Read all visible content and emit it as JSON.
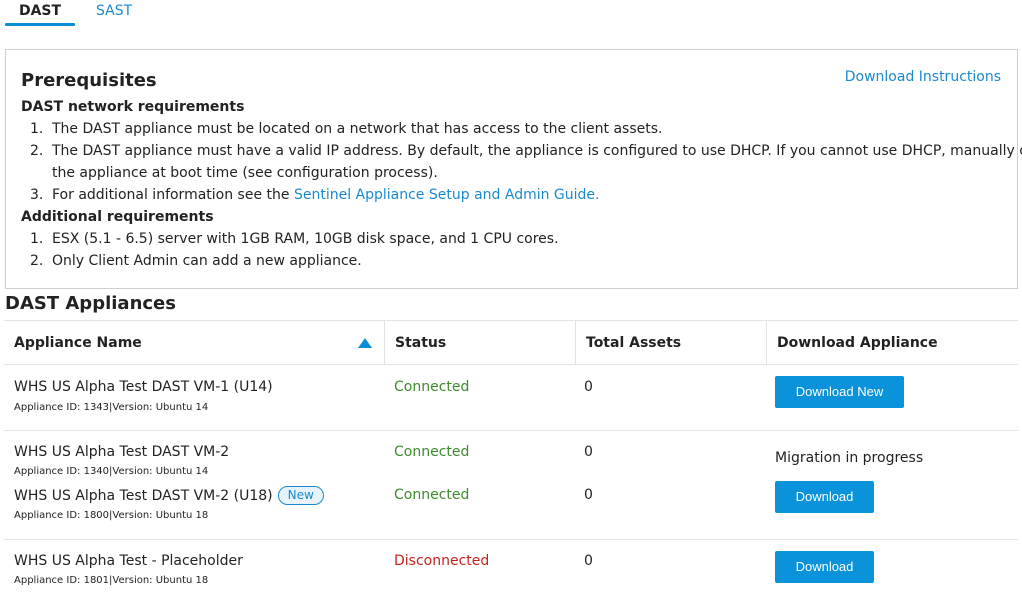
{
  "tabs": [
    {
      "label": "DAST",
      "active": true
    },
    {
      "label": "SAST",
      "active": false
    }
  ],
  "prerequisites": {
    "title": "Prerequisites",
    "download_instructions_label": "Download Instructions",
    "network_heading": "DAST network requirements",
    "network_items": [
      {
        "num": "1.",
        "text": "The DAST appliance must be located on a network that has access to the client assets."
      },
      {
        "num": "2.",
        "text": "The DAST appliance must have a valid IP address. By default, the appliance is configured to use DHCP. If you cannot use DHCP, manually configure",
        "continuation": "the appliance at boot time (see configuration process)."
      },
      {
        "num": "3.",
        "text": "For additional information see the ",
        "link": "Sentinel Appliance Setup and Admin Guide."
      }
    ],
    "additional_heading": "Additional requirements",
    "additional_items": [
      {
        "num": "1.",
        "text": "ESX (5.1 - 6.5) server with 1GB RAM, 10GB disk space, and 1 CPU cores."
      },
      {
        "num": "2.",
        "text": "Only Client Admin can add a new appliance."
      }
    ]
  },
  "appliances": {
    "title": "DAST Appliances",
    "columns": [
      "Appliance Name",
      "Status",
      "Total Assets",
      "Download Appliance"
    ],
    "sort": {
      "column": "Appliance Name",
      "direction": "ascending"
    },
    "rows": [
      {
        "entries": [
          {
            "name": "WHS US Alpha Test DAST VM-1 (U14)",
            "meta": "Appliance ID: 1343|Version: Ubuntu 14",
            "status": "Connected",
            "assets": "0",
            "action": {
              "type": "button",
              "label": "Download New"
            }
          }
        ]
      },
      {
        "entries": [
          {
            "name": "WHS US Alpha Test DAST VM-2",
            "meta": "Appliance ID: 1340|Version: Ubuntu 14",
            "status": "Connected",
            "assets": "0",
            "action": {
              "type": "text",
              "label": "Migration in progress"
            }
          },
          {
            "name": "WHS US Alpha Test DAST VM-2 (U18)",
            "badge": "New",
            "meta": "Appliance ID: 1800|Version: Ubuntu 18",
            "status": "Connected",
            "assets": "0",
            "action": {
              "type": "button",
              "label": "Download"
            }
          }
        ]
      },
      {
        "entries": [
          {
            "name": "WHS US Alpha Test - Placeholder",
            "meta": "Appliance ID: 1801|Version: Ubuntu 18",
            "status": "Disconnected",
            "assets": "0",
            "action": {
              "type": "button",
              "label": "Download"
            }
          }
        ]
      }
    ]
  },
  "colors": {
    "accent": "#0a93da",
    "link": "#1a8ad0",
    "connected": "#3f8a2e",
    "disconnected": "#c4231c"
  }
}
